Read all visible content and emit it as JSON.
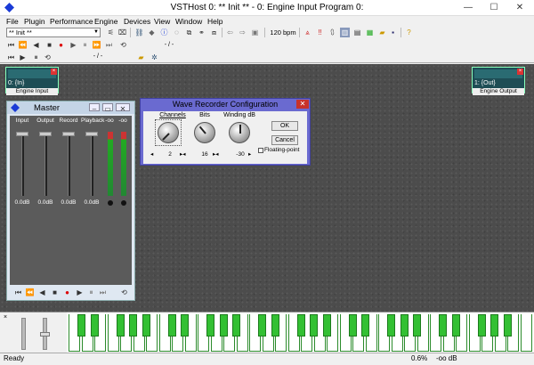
{
  "titlebar": {
    "title": "VSTHost 0: ** Init ** - 0: Engine Input Program 0:",
    "minimize": "—",
    "maximize": "☐",
    "close": "✕"
  },
  "menu": [
    "File",
    "Plugin",
    "Performance",
    "Engine",
    "Devices",
    "View",
    "Window",
    "Help"
  ],
  "toolbar": {
    "program": "** Init **",
    "bpm": "120 bpm"
  },
  "toolbar2": {
    "position1": "- / -"
  },
  "toolbar3": {
    "position2": "- / -"
  },
  "engine_input": {
    "number": "0:",
    "name": "{In}",
    "label": "Engine Input"
  },
  "engine_output": {
    "number": "1:",
    "name": "{Out}",
    "label": "Engine Output"
  },
  "master": {
    "title": "Master",
    "channels": [
      {
        "label": "Input",
        "value": "0.0dB"
      },
      {
        "label": "Output",
        "value": "0.0dB"
      },
      {
        "label": "Record",
        "value": "0.0dB"
      },
      {
        "label": "Playback",
        "value": "0.0dB"
      }
    ],
    "meters": [
      "-oo",
      "-oo"
    ]
  },
  "wave_recorder": {
    "title": "Wave Recorder Configuration",
    "channels_label": "Channels",
    "channels_value": "2",
    "bits_label": "Bits",
    "bits_value": "16",
    "winding_label": "Winding dB",
    "winding_value": "-30",
    "ok": "OK",
    "cancel": "Cancel",
    "floating_point": "Floating-point"
  },
  "keyboard": {
    "close": "×"
  },
  "status": {
    "text": "Ready",
    "cpu": "0.6%",
    "level": "-oo dB"
  },
  "colors": {
    "workspace": "#4c4c4c",
    "engine_module": "#1e4d55",
    "dialog_frame": "#6a6ad0",
    "keyboard_black": "#33c033",
    "keyboard_border": "#2b8b2b"
  }
}
